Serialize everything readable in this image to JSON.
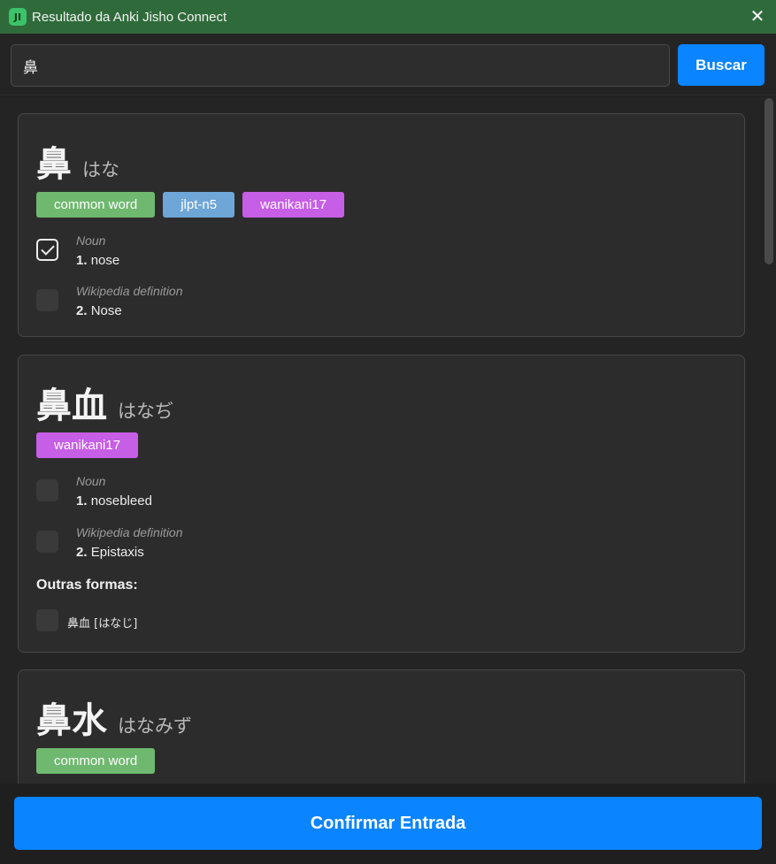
{
  "window": {
    "title": "Resultado da Anki Jisho Connect",
    "icon_text": "JI"
  },
  "search": {
    "value": "鼻",
    "button_label": "Buscar"
  },
  "results": [
    {
      "word": "鼻",
      "reading": "はな",
      "tags": [
        "common word",
        "jlpt-n5",
        "wanikani17"
      ],
      "senses": [
        {
          "pos": "Noun",
          "num": "1.",
          "text": "nose",
          "checked": true
        },
        {
          "pos": "Wikipedia definition",
          "num": "2.",
          "text": "Nose",
          "checked": false
        }
      ]
    },
    {
      "word": "鼻血",
      "reading": "はなぢ",
      "tags": [
        "wanikani17"
      ],
      "senses": [
        {
          "pos": "Noun",
          "num": "1.",
          "text": "nosebleed",
          "checked": false
        },
        {
          "pos": "Wikipedia definition",
          "num": "2.",
          "text": "Epistaxis",
          "checked": false
        }
      ],
      "other_forms_title": "Outras formas:",
      "other_forms": [
        {
          "text": "鼻血 [はなじ]",
          "checked": false
        }
      ]
    },
    {
      "word": "鼻水",
      "reading": "はなみず",
      "tags": [
        "common word"
      ]
    }
  ],
  "footer": {
    "confirm_label": "Confirmar Entrada"
  },
  "colors": {
    "titlebar": "#2f6b3a",
    "accent": "#0a84ff",
    "tag_common": "#6fb86f",
    "tag_jlpt": "#6ea6d8",
    "tag_wanikani": "#c75ee6"
  }
}
